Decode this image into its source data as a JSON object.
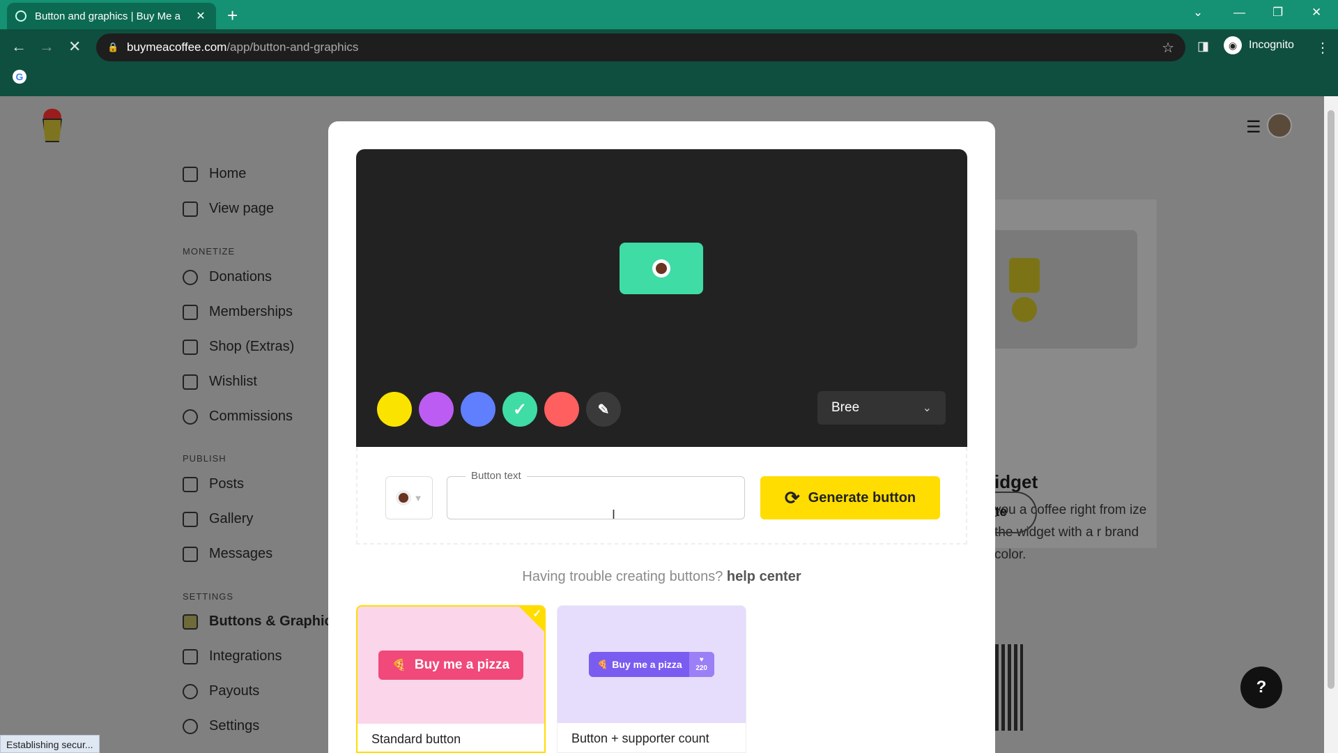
{
  "browser": {
    "tab_title": "Button and graphics | Buy Me a",
    "url_domain": "buymeacoffee.com",
    "url_path": "/app/button-and-graphics",
    "incognito_label": "Incognito",
    "status_text": "Establishing secur..."
  },
  "sidebar": {
    "items_top": [
      {
        "label": "Home",
        "icon": "home-icon"
      },
      {
        "label": "View page",
        "icon": "layout-icon"
      }
    ],
    "monetize_title": "MONETIZE",
    "monetize": [
      {
        "label": "Donations",
        "icon": "heart-icon"
      },
      {
        "label": "Memberships",
        "icon": "lock-icon"
      },
      {
        "label": "Shop (Extras)",
        "icon": "gift-icon"
      },
      {
        "label": "Wishlist",
        "icon": "wishlist-icon"
      },
      {
        "label": "Commissions",
        "icon": "commissions-icon"
      }
    ],
    "publish_title": "PUBLISH",
    "publish": [
      {
        "label": "Posts",
        "icon": "posts-icon"
      },
      {
        "label": "Gallery",
        "icon": "gallery-icon"
      },
      {
        "label": "Messages",
        "icon": "mail-icon"
      }
    ],
    "settings_title": "SETTINGS",
    "settings": [
      {
        "label": "Buttons & Graphic",
        "icon": "code-icon",
        "active": true
      },
      {
        "label": "Integrations",
        "icon": "bolt-icon"
      },
      {
        "label": "Payouts",
        "icon": "dollar-icon"
      },
      {
        "label": "Settings",
        "icon": "gear-icon"
      }
    ]
  },
  "background": {
    "widget_heading": "idget",
    "widget_desc": "you a coffee right from ize the widget with a r brand color.",
    "widget_button": "te",
    "help_fab": "?"
  },
  "modal": {
    "swatches": [
      {
        "color": "#fbe300",
        "name": "yellow"
      },
      {
        "color": "#bd5cf3",
        "name": "purple"
      },
      {
        "color": "#5f7fff",
        "name": "blue"
      },
      {
        "color": "#40dca5",
        "name": "green",
        "selected": true
      },
      {
        "color": "#ff5f5f",
        "name": "red"
      }
    ],
    "font_select": "Bree",
    "button_text_label": "Button text",
    "button_text_value": "",
    "generate_label": "Generate button",
    "trouble_text": "Having trouble creating buttons?",
    "help_link": "help center",
    "styles": [
      {
        "caption": "Standard button",
        "sample": "Buy me a pizza",
        "selected": true
      },
      {
        "caption": "Button + supporter count",
        "sample": "Buy me a pizza",
        "count": "220"
      }
    ],
    "preview_bg": "#222222",
    "accent": "#ffdd00"
  }
}
